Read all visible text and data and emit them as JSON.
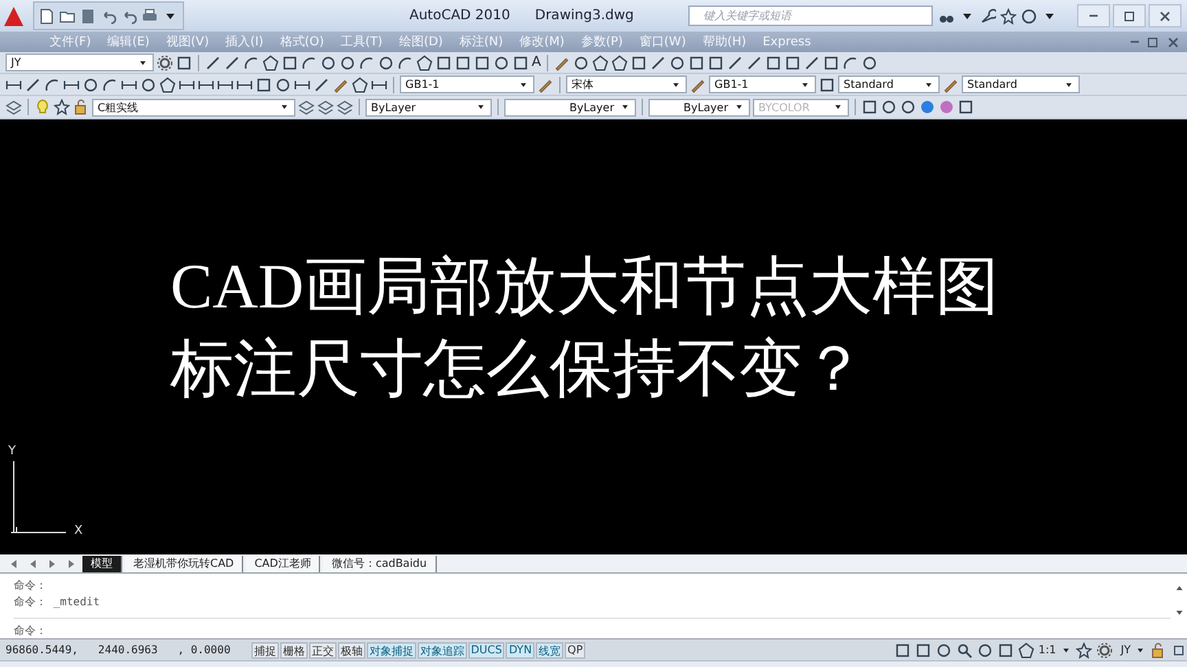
{
  "window": {
    "app_title": "AutoCAD 2010",
    "file_title": "Drawing3.dwg"
  },
  "search": {
    "placeholder": "键入关键字或短语"
  },
  "menu": [
    "文件(F)",
    "编辑(E)",
    "视图(V)",
    "插入(I)",
    "格式(O)",
    "工具(T)",
    "绘图(D)",
    "标注(N)",
    "修改(M)",
    "参数(P)",
    "窗口(W)",
    "帮助(H)",
    "Express"
  ],
  "toolbar_draw": {
    "workspace": "JY",
    "text_tool": "A"
  },
  "toolbar_styles": {
    "dim_style": "GB1-1",
    "text_style_font": "宋体",
    "dim_style_2": "GB1-1",
    "table_style": "Standard",
    "mleader_style": "Standard"
  },
  "toolbar_layers": {
    "layer": "C粗实线",
    "color_control": "ByLayer",
    "linetype": "ByLayer",
    "lineweight": "ByLayer",
    "plot_style": {
      "value": "BYCOLOR",
      "disabled": true
    }
  },
  "canvas": {
    "overlay_lines": [
      "CAD画局部放大和节点大样图",
      "标注尺寸怎么保持不变？"
    ],
    "ucs_y": "Y",
    "ucs_x": "X"
  },
  "layout_tabs": [
    {
      "label": "模型",
      "selected": true
    },
    {
      "label": "老湿机带你玩转CAD",
      "selected": false
    },
    {
      "label": "CAD江老师",
      "selected": false
    },
    {
      "label": "微信号：cadBaidu",
      "selected": false
    }
  ],
  "command": {
    "history": [
      "命令：",
      "命令： _mtedit"
    ],
    "prompt": "命令："
  },
  "status_bar": {
    "coordinates": "96860.5449,   2440.6963   , 0.0000",
    "toggles": [
      {
        "label": "捕捉",
        "on": false
      },
      {
        "label": "栅格",
        "on": false
      },
      {
        "label": "正交",
        "on": false
      },
      {
        "label": "极轴",
        "on": false
      },
      {
        "label": "对象捕捉",
        "on": true
      },
      {
        "label": "对象追踪",
        "on": true
      },
      {
        "label": "DUCS",
        "on": true
      },
      {
        "label": "DYN",
        "on": true
      },
      {
        "label": "线宽",
        "on": true
      },
      {
        "label": "QP",
        "on": false
      }
    ],
    "annotation_scale": "1:1",
    "workspace": "JY"
  }
}
